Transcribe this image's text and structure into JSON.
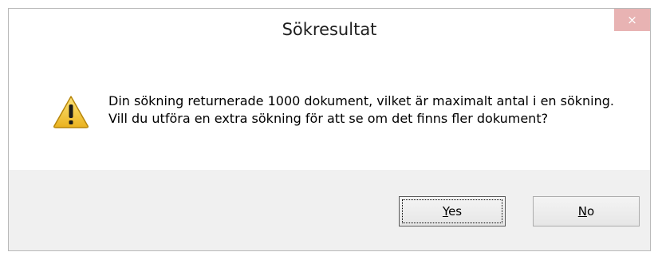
{
  "dialog": {
    "title": "Sökresultat",
    "close_label": "×",
    "message": "Din sökning returnerade 1000 dokument, vilket är maximalt antal i en sökning. Vill du utföra en extra sökning för att se om det finns fler dokument?",
    "icon": "warning-icon"
  },
  "buttons": {
    "yes_mnemonic": "Y",
    "yes_rest": "es",
    "no_mnemonic": "N",
    "no_rest": "o"
  },
  "colors": {
    "close_button": "#e8b3b3",
    "footer": "#f0f0f0",
    "warning_fill": "#f4c430"
  }
}
